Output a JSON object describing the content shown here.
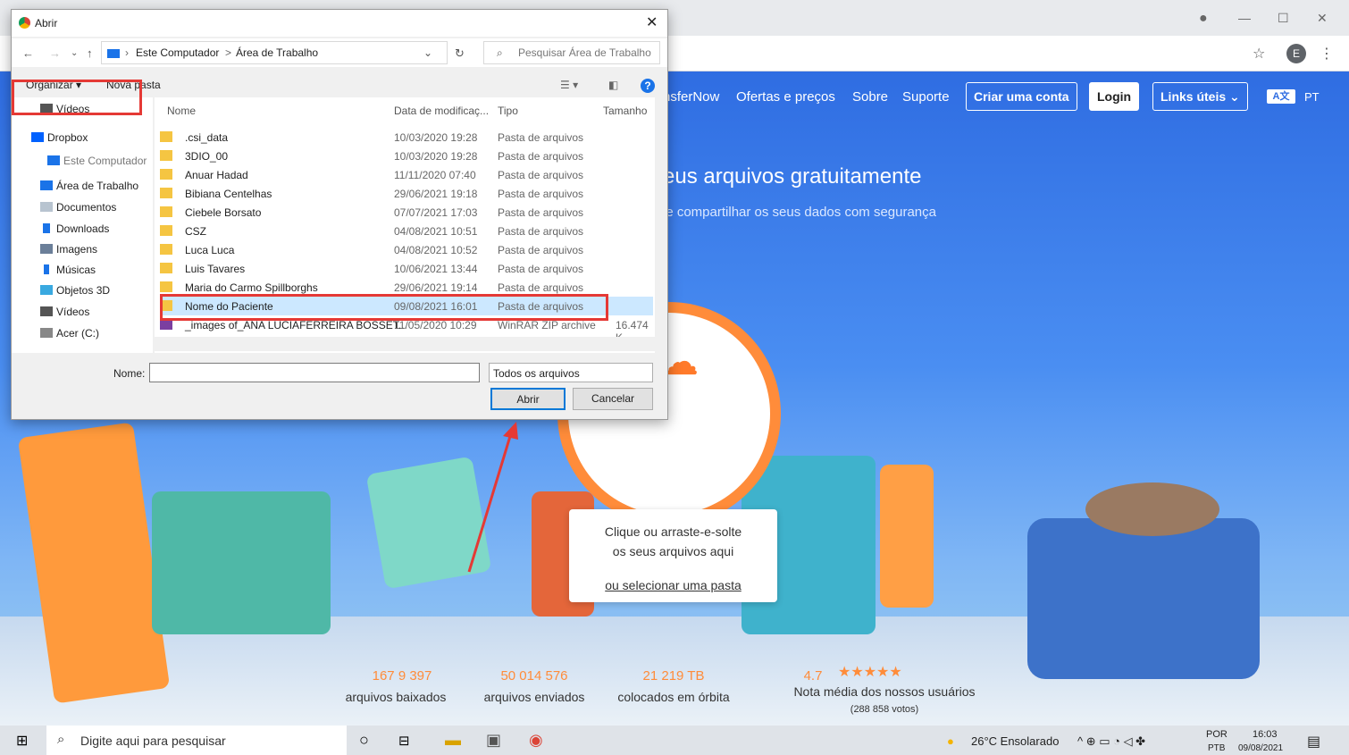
{
  "browser": {
    "minimize": "—",
    "maximize": "☐",
    "close": "✕",
    "star": "☆",
    "avatar": "E",
    "menu": "⋮"
  },
  "site": {
    "nav": [
      "nsferNow",
      "Ofertas e preços",
      "Sobre",
      "Suporte"
    ],
    "create_account": "Criar uma conta",
    "login": "Login",
    "links": "Links úteis ⌄",
    "lang_icon": "A文",
    "lang": "PT",
    "hero_title": "eus arquivos gratuitamente",
    "hero_sub": "le compartilhar os seus dados com segurança",
    "drop_line1": "Clique ou arraste-e-solte",
    "drop_line2": "os seus arquivos aqui",
    "drop_link": "ou selecionar uma pasta",
    "stats": [
      {
        "num": "167 9  397",
        "lbl": "arquivos baixados"
      },
      {
        "num": "50 014 576",
        "lbl": "arquivos enviados"
      },
      {
        "num": "21 219 TB",
        "lbl": "colocados em órbita"
      },
      {
        "num": "4.7",
        "lbl": "Nota média dos nossos usuários"
      }
    ],
    "stars": "★★★★★",
    "votes": "(288 858 votos)"
  },
  "taskbar": {
    "search": "Digite aqui para pesquisar",
    "weather": "26°C  Ensolarado",
    "lang1": "POR",
    "lang2": "PTB",
    "time": "16:03",
    "date": "09/08/2021"
  },
  "dialog": {
    "title": "Abrir",
    "close": "✕",
    "crumbs": [
      "Este Computador",
      ">",
      "Área de Trabalho"
    ],
    "search_placeholder": "Pesquisar Área de Trabalho",
    "organize": "Organizar ▾",
    "new_folder": "Nova pasta",
    "tree": [
      "Vídeos",
      "Dropbox",
      "Este Computador",
      "Área de Trabalho",
      "Documentos",
      "Downloads",
      "Imagens",
      "Músicas",
      "Objetos 3D",
      "Vídeos",
      "Acer (C:)"
    ],
    "columns": [
      "Nome",
      "Data de modificaç...",
      "Tipo",
      "Tamanho"
    ],
    "files": [
      {
        "name": ".csi_data",
        "date": "10/03/2020 19:28",
        "type": "Pasta de arquivos",
        "size": ""
      },
      {
        "name": "3DIO_00",
        "date": "10/03/2020 19:28",
        "type": "Pasta de arquivos",
        "size": ""
      },
      {
        "name": "Anuar Hadad",
        "date": "11/11/2020 07:40",
        "type": "Pasta de arquivos",
        "size": ""
      },
      {
        "name": "Bibiana Centelhas",
        "date": "29/06/2021 19:18",
        "type": "Pasta de arquivos",
        "size": ""
      },
      {
        "name": "Ciebele Borsato",
        "date": "07/07/2021 17:03",
        "type": "Pasta de arquivos",
        "size": ""
      },
      {
        "name": "CSZ",
        "date": "04/08/2021 10:51",
        "type": "Pasta de arquivos",
        "size": ""
      },
      {
        "name": "Luca Luca",
        "date": "04/08/2021 10:52",
        "type": "Pasta de arquivos",
        "size": ""
      },
      {
        "name": "Luis Tavares",
        "date": "10/06/2021 13:44",
        "type": "Pasta de arquivos",
        "size": ""
      },
      {
        "name": "Maria do Carmo Spillborghs",
        "date": "29/06/2021 19:14",
        "type": "Pasta de arquivos",
        "size": ""
      },
      {
        "name": "Nome do Paciente",
        "date": "09/08/2021 16:01",
        "type": "Pasta de arquivos",
        "size": ""
      },
      {
        "name": "_images of_ANA LUCIAFERREIRA BOSSET...",
        "date": "11/05/2020 10:29",
        "type": "WinRAR ZIP archive",
        "size": "16.474 K"
      }
    ],
    "name_label": "Nome:",
    "filter": "Todos os arquivos",
    "open": "Abrir",
    "cancel": "Cancelar"
  },
  "colors": {
    "highlight": "#e53935",
    "accent": "#ff8c3a",
    "site_blue": "#2f6de2"
  }
}
